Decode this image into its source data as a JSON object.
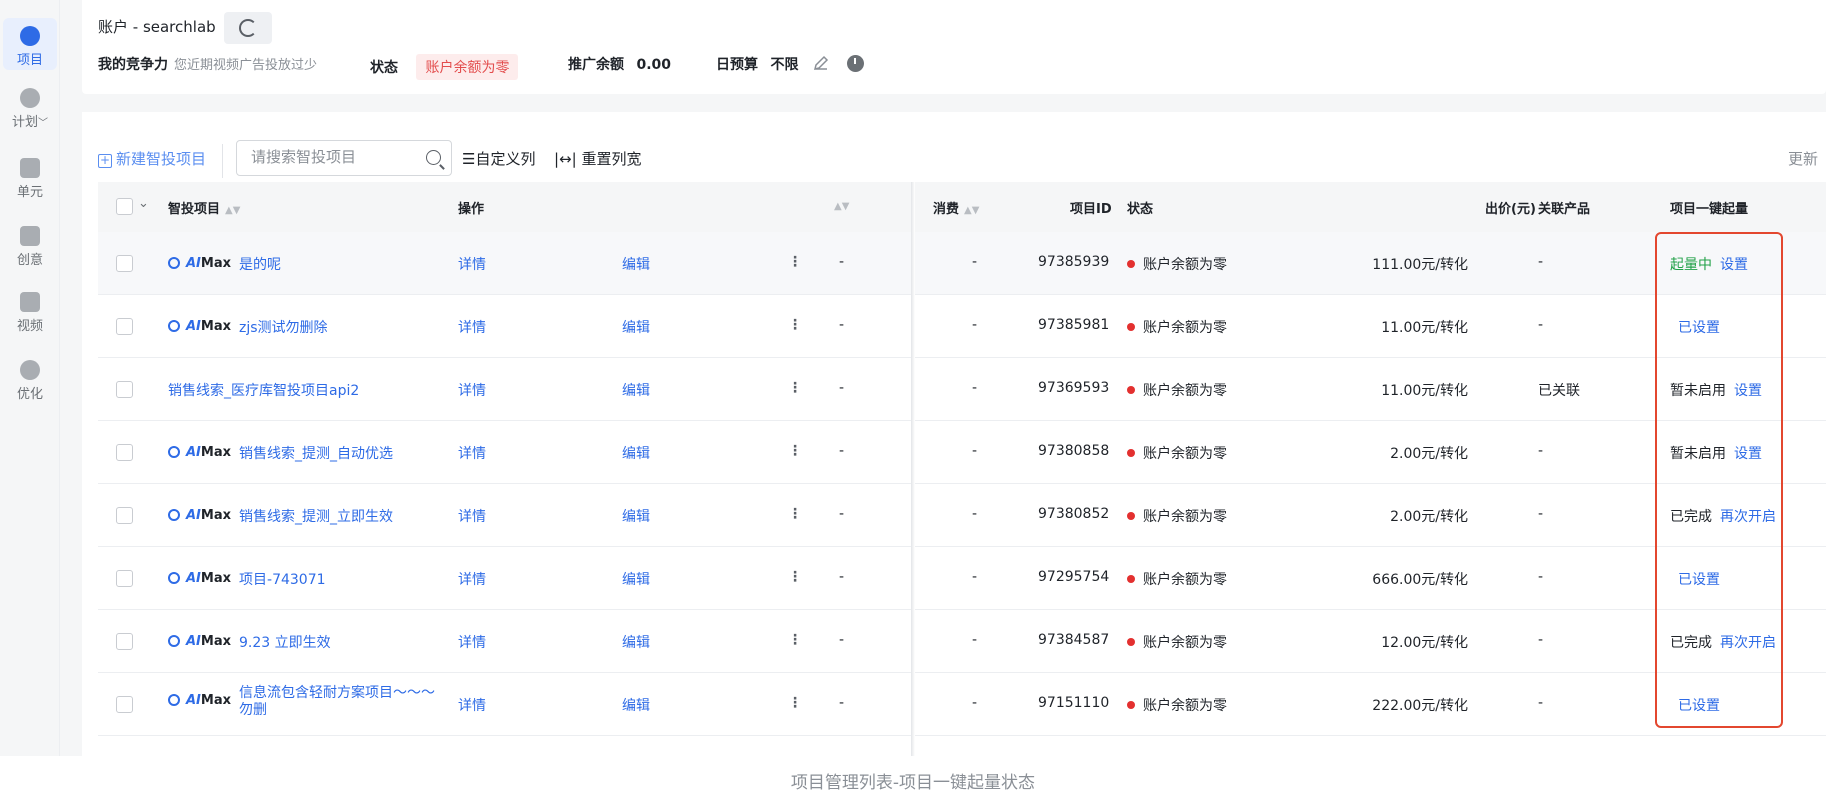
{
  "sidebar": {
    "items": [
      {
        "label": "项目",
        "active": true
      },
      {
        "label": "计划",
        "has_chevron": true
      },
      {
        "label": "单元"
      },
      {
        "label": "创意"
      },
      {
        "label": "视频"
      },
      {
        "label": "优化"
      }
    ]
  },
  "header": {
    "account_title": "账户 - searchlab",
    "competitiveness_label": "我的竞争力",
    "competitiveness_hint": "您近期视频广告投放过少",
    "status_label": "状态",
    "status_value": "账户余额为零",
    "balance_label": "推广余额",
    "balance_value": "0.00",
    "budget_label": "日预算",
    "budget_value": "不限"
  },
  "toolbar": {
    "new_project": "新建智投项目",
    "search_placeholder": "请搜索智投项目",
    "custom_columns": "自定义列",
    "reset_width": "重置列宽",
    "update": "更新"
  },
  "table": {
    "headers": {
      "name": "智投项目",
      "ops": "操作",
      "cost": "消费",
      "project_id": "项目ID",
      "status": "状态",
      "bid": "出价(元)",
      "product": "关联产品",
      "boost": "项目一键起量"
    },
    "detail_label": "详情",
    "edit_label": "编辑",
    "rows": [
      {
        "aimax": true,
        "name": "是的呢",
        "col_a": "-",
        "cost": "-",
        "id": "97385939",
        "status": "账户余额为零",
        "bid": "111.00元/转化",
        "product": "-",
        "boost_state": "起量中",
        "boost_action": "设置",
        "boost_state_color": "green"
      },
      {
        "aimax": true,
        "name": "zjs测试勿删除",
        "col_a": "-",
        "cost": "-",
        "id": "97385981",
        "status": "账户余额为零",
        "bid": "11.00元/转化",
        "product": "-",
        "boost_state": "",
        "boost_action": "已设置"
      },
      {
        "aimax": false,
        "name": "销售线索_医疗库智投项目api2",
        "col_a": "-",
        "cost": "-",
        "id": "97369593",
        "status": "账户余额为零",
        "bid": "11.00元/转化",
        "product": "已关联",
        "boost_state": "暂未启用",
        "boost_action": "设置"
      },
      {
        "aimax": true,
        "name": "销售线索_提测_自动优选",
        "col_a": "-",
        "cost": "-",
        "id": "97380858",
        "status": "账户余额为零",
        "bid": "2.00元/转化",
        "product": "-",
        "boost_state": "暂未启用",
        "boost_action": "设置"
      },
      {
        "aimax": true,
        "name": "销售线索_提测_立即生效",
        "col_a": "-",
        "cost": "-",
        "id": "97380852",
        "status": "账户余额为零",
        "bid": "2.00元/转化",
        "product": "-",
        "boost_state": "已完成",
        "boost_action": "再次开启"
      },
      {
        "aimax": true,
        "name": "项目-743071",
        "col_a": "-",
        "cost": "-",
        "id": "97295754",
        "status": "账户余额为零",
        "bid": "666.00元/转化",
        "product": "-",
        "boost_state": "",
        "boost_action": "已设置"
      },
      {
        "aimax": true,
        "name": "9.23 立即生效",
        "col_a": "-",
        "cost": "-",
        "id": "97384587",
        "status": "账户余额为零",
        "bid": "12.00元/转化",
        "product": "-",
        "boost_state": "已完成",
        "boost_action": "再次开启"
      },
      {
        "aimax": true,
        "name": "信息流包含轻耐方案项目～～～",
        "name_line2": "勿删",
        "col_a": "-",
        "cost": "-",
        "id": "97151110",
        "status": "账户余额为零",
        "bid": "222.00元/转化",
        "product": "-",
        "boost_state": "",
        "boost_action": "已设置"
      }
    ]
  },
  "caption": "项目管理列表-项目一键起量状态",
  "colors": {
    "accent": "#2e6be6",
    "danger": "#e3302f",
    "success": "#21a148",
    "highlight": "#e3472f"
  }
}
